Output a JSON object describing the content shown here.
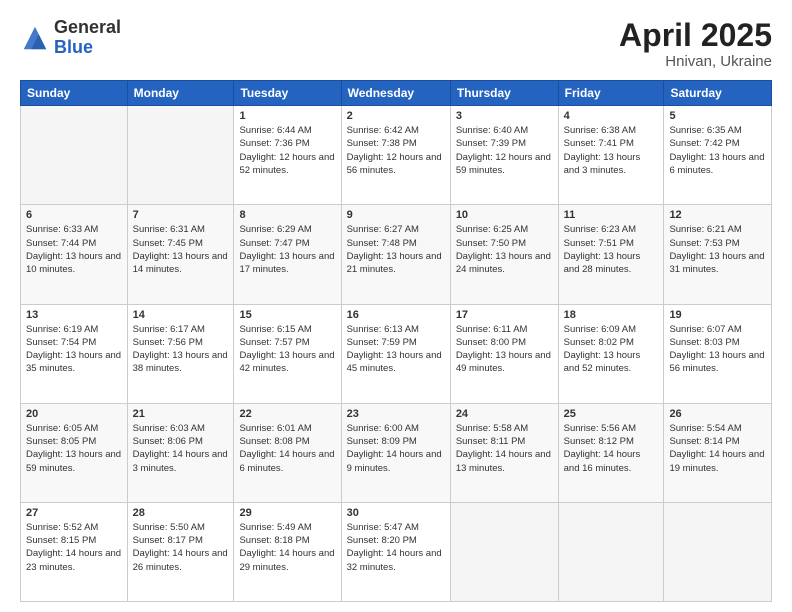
{
  "logo": {
    "general": "General",
    "blue": "Blue"
  },
  "title": "April 2025",
  "location": "Hnivan, Ukraine",
  "days_of_week": [
    "Sunday",
    "Monday",
    "Tuesday",
    "Wednesday",
    "Thursday",
    "Friday",
    "Saturday"
  ],
  "weeks": [
    [
      {
        "day": "",
        "sunrise": "",
        "sunset": "",
        "daylight": ""
      },
      {
        "day": "",
        "sunrise": "",
        "sunset": "",
        "daylight": ""
      },
      {
        "day": "1",
        "sunrise": "Sunrise: 6:44 AM",
        "sunset": "Sunset: 7:36 PM",
        "daylight": "Daylight: 12 hours and 52 minutes."
      },
      {
        "day": "2",
        "sunrise": "Sunrise: 6:42 AM",
        "sunset": "Sunset: 7:38 PM",
        "daylight": "Daylight: 12 hours and 56 minutes."
      },
      {
        "day": "3",
        "sunrise": "Sunrise: 6:40 AM",
        "sunset": "Sunset: 7:39 PM",
        "daylight": "Daylight: 12 hours and 59 minutes."
      },
      {
        "day": "4",
        "sunrise": "Sunrise: 6:38 AM",
        "sunset": "Sunset: 7:41 PM",
        "daylight": "Daylight: 13 hours and 3 minutes."
      },
      {
        "day": "5",
        "sunrise": "Sunrise: 6:35 AM",
        "sunset": "Sunset: 7:42 PM",
        "daylight": "Daylight: 13 hours and 6 minutes."
      }
    ],
    [
      {
        "day": "6",
        "sunrise": "Sunrise: 6:33 AM",
        "sunset": "Sunset: 7:44 PM",
        "daylight": "Daylight: 13 hours and 10 minutes."
      },
      {
        "day": "7",
        "sunrise": "Sunrise: 6:31 AM",
        "sunset": "Sunset: 7:45 PM",
        "daylight": "Daylight: 13 hours and 14 minutes."
      },
      {
        "day": "8",
        "sunrise": "Sunrise: 6:29 AM",
        "sunset": "Sunset: 7:47 PM",
        "daylight": "Daylight: 13 hours and 17 minutes."
      },
      {
        "day": "9",
        "sunrise": "Sunrise: 6:27 AM",
        "sunset": "Sunset: 7:48 PM",
        "daylight": "Daylight: 13 hours and 21 minutes."
      },
      {
        "day": "10",
        "sunrise": "Sunrise: 6:25 AM",
        "sunset": "Sunset: 7:50 PM",
        "daylight": "Daylight: 13 hours and 24 minutes."
      },
      {
        "day": "11",
        "sunrise": "Sunrise: 6:23 AM",
        "sunset": "Sunset: 7:51 PM",
        "daylight": "Daylight: 13 hours and 28 minutes."
      },
      {
        "day": "12",
        "sunrise": "Sunrise: 6:21 AM",
        "sunset": "Sunset: 7:53 PM",
        "daylight": "Daylight: 13 hours and 31 minutes."
      }
    ],
    [
      {
        "day": "13",
        "sunrise": "Sunrise: 6:19 AM",
        "sunset": "Sunset: 7:54 PM",
        "daylight": "Daylight: 13 hours and 35 minutes."
      },
      {
        "day": "14",
        "sunrise": "Sunrise: 6:17 AM",
        "sunset": "Sunset: 7:56 PM",
        "daylight": "Daylight: 13 hours and 38 minutes."
      },
      {
        "day": "15",
        "sunrise": "Sunrise: 6:15 AM",
        "sunset": "Sunset: 7:57 PM",
        "daylight": "Daylight: 13 hours and 42 minutes."
      },
      {
        "day": "16",
        "sunrise": "Sunrise: 6:13 AM",
        "sunset": "Sunset: 7:59 PM",
        "daylight": "Daylight: 13 hours and 45 minutes."
      },
      {
        "day": "17",
        "sunrise": "Sunrise: 6:11 AM",
        "sunset": "Sunset: 8:00 PM",
        "daylight": "Daylight: 13 hours and 49 minutes."
      },
      {
        "day": "18",
        "sunrise": "Sunrise: 6:09 AM",
        "sunset": "Sunset: 8:02 PM",
        "daylight": "Daylight: 13 hours and 52 minutes."
      },
      {
        "day": "19",
        "sunrise": "Sunrise: 6:07 AM",
        "sunset": "Sunset: 8:03 PM",
        "daylight": "Daylight: 13 hours and 56 minutes."
      }
    ],
    [
      {
        "day": "20",
        "sunrise": "Sunrise: 6:05 AM",
        "sunset": "Sunset: 8:05 PM",
        "daylight": "Daylight: 13 hours and 59 minutes."
      },
      {
        "day": "21",
        "sunrise": "Sunrise: 6:03 AM",
        "sunset": "Sunset: 8:06 PM",
        "daylight": "Daylight: 14 hours and 3 minutes."
      },
      {
        "day": "22",
        "sunrise": "Sunrise: 6:01 AM",
        "sunset": "Sunset: 8:08 PM",
        "daylight": "Daylight: 14 hours and 6 minutes."
      },
      {
        "day": "23",
        "sunrise": "Sunrise: 6:00 AM",
        "sunset": "Sunset: 8:09 PM",
        "daylight": "Daylight: 14 hours and 9 minutes."
      },
      {
        "day": "24",
        "sunrise": "Sunrise: 5:58 AM",
        "sunset": "Sunset: 8:11 PM",
        "daylight": "Daylight: 14 hours and 13 minutes."
      },
      {
        "day": "25",
        "sunrise": "Sunrise: 5:56 AM",
        "sunset": "Sunset: 8:12 PM",
        "daylight": "Daylight: 14 hours and 16 minutes."
      },
      {
        "day": "26",
        "sunrise": "Sunrise: 5:54 AM",
        "sunset": "Sunset: 8:14 PM",
        "daylight": "Daylight: 14 hours and 19 minutes."
      }
    ],
    [
      {
        "day": "27",
        "sunrise": "Sunrise: 5:52 AM",
        "sunset": "Sunset: 8:15 PM",
        "daylight": "Daylight: 14 hours and 23 minutes."
      },
      {
        "day": "28",
        "sunrise": "Sunrise: 5:50 AM",
        "sunset": "Sunset: 8:17 PM",
        "daylight": "Daylight: 14 hours and 26 minutes."
      },
      {
        "day": "29",
        "sunrise": "Sunrise: 5:49 AM",
        "sunset": "Sunset: 8:18 PM",
        "daylight": "Daylight: 14 hours and 29 minutes."
      },
      {
        "day": "30",
        "sunrise": "Sunrise: 5:47 AM",
        "sunset": "Sunset: 8:20 PM",
        "daylight": "Daylight: 14 hours and 32 minutes."
      },
      {
        "day": "",
        "sunrise": "",
        "sunset": "",
        "daylight": ""
      },
      {
        "day": "",
        "sunrise": "",
        "sunset": "",
        "daylight": ""
      },
      {
        "day": "",
        "sunrise": "",
        "sunset": "",
        "daylight": ""
      }
    ]
  ]
}
